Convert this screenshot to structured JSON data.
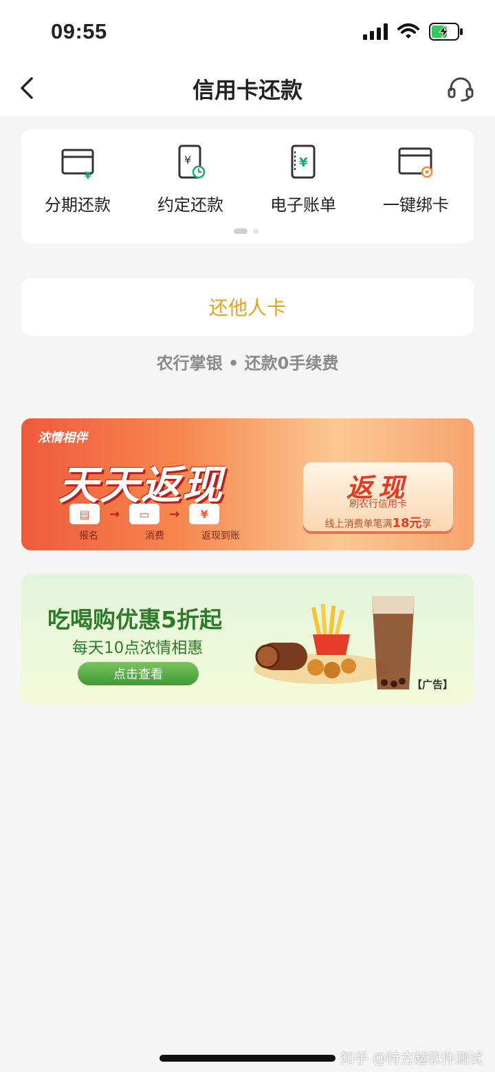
{
  "status_bar": {
    "time": "09:55"
  },
  "nav": {
    "title": "信用卡还款"
  },
  "shortcuts": [
    {
      "label": "分期还款",
      "icon": "card-installment-icon"
    },
    {
      "label": "约定还款",
      "icon": "scheduled-payment-icon"
    },
    {
      "label": "电子账单",
      "icon": "e-bill-icon"
    },
    {
      "label": "一键绑卡",
      "icon": "bind-card-icon"
    }
  ],
  "pager": {
    "pages": 2,
    "current": 1
  },
  "other_card": {
    "label": "还他人卡"
  },
  "promo": {
    "text": "农行掌银 • 还款0手续费"
  },
  "banner_cashback": {
    "tag": "浓情相伴",
    "title": "天天返现",
    "steps": [
      "报名",
      "消费",
      "返现到账"
    ],
    "card_title": "返现",
    "card_sub": "刷农行信用卡",
    "card_line_prefix": "线上消费单笔满",
    "card_line_amount": "18元",
    "card_line_suffix": "享"
  },
  "banner_food": {
    "title": "吃喝购优惠5折起",
    "subtitle": "每天10点浓情相惠",
    "button": "点击查看",
    "ad_label": "【广告】"
  },
  "watermark": "知乎 @特方越软件测试",
  "colors": {
    "accent_orange": "#e8a21a",
    "brand_green": "#2d7a28",
    "icon_green": "#1aa86b",
    "icon_orange": "#f08a3c"
  }
}
